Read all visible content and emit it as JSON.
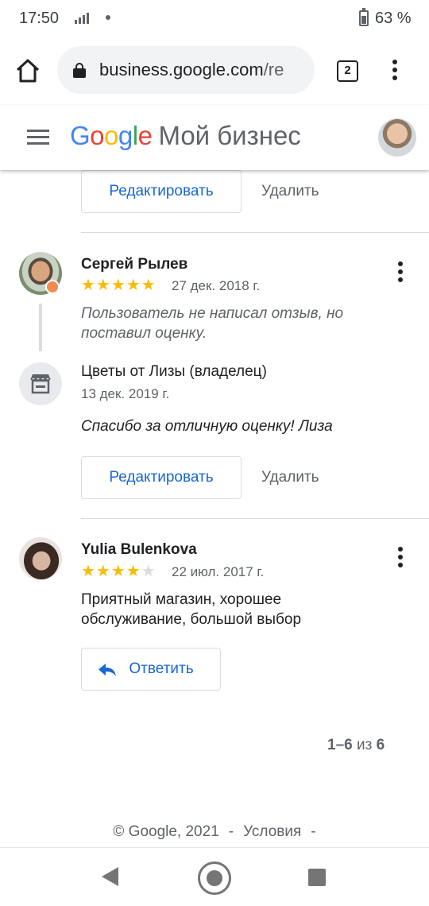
{
  "status_bar": {
    "time": "17:50",
    "battery": "63 %"
  },
  "browser": {
    "url_host": "business.google.com",
    "url_rest": "/re",
    "tab_count": "2"
  },
  "app": {
    "logo": {
      "g": "G",
      "o1": "o",
      "o2": "o",
      "g2": "g",
      "l": "l",
      "e": "e"
    },
    "product_name": "Мой бизнес"
  },
  "reviews": [
    {
      "owner_reply_actions": {
        "edit_label": "Редактировать",
        "delete_label": "Удалить"
      }
    },
    {
      "author": "Сергей Рылев",
      "rating": 5,
      "stars_on": "★★★★★",
      "stars_off": "",
      "date": "27 дек. 2018 г.",
      "text": "Пользователь не написал отзыв, но поставил оценку.",
      "reply": {
        "owner_name": "Цветы от Лизы (владелец)",
        "date": "13 дек. 2019 г.",
        "text": "Спасибо за отличную оценку! Лиза",
        "edit_label": "Редактировать",
        "delete_label": "Удалить"
      }
    },
    {
      "author": "Yulia Bulenkova",
      "rating": 4,
      "stars_on": "★★★★",
      "stars_off": "★",
      "date": "22 июл. 2017 г.",
      "text": "Приятный магазин, хорошее обслуживание, большой выбор",
      "reply_label": "Ответить"
    }
  ],
  "pagination": {
    "range": "1–6",
    "of": "из",
    "total": "6"
  },
  "footer": {
    "copyright": "© Google, 2021",
    "sep1": "-",
    "terms": "Условия",
    "sep2": "-"
  },
  "colors": {
    "link_blue": "#1967d2",
    "star_yellow": "#fbbc04"
  }
}
